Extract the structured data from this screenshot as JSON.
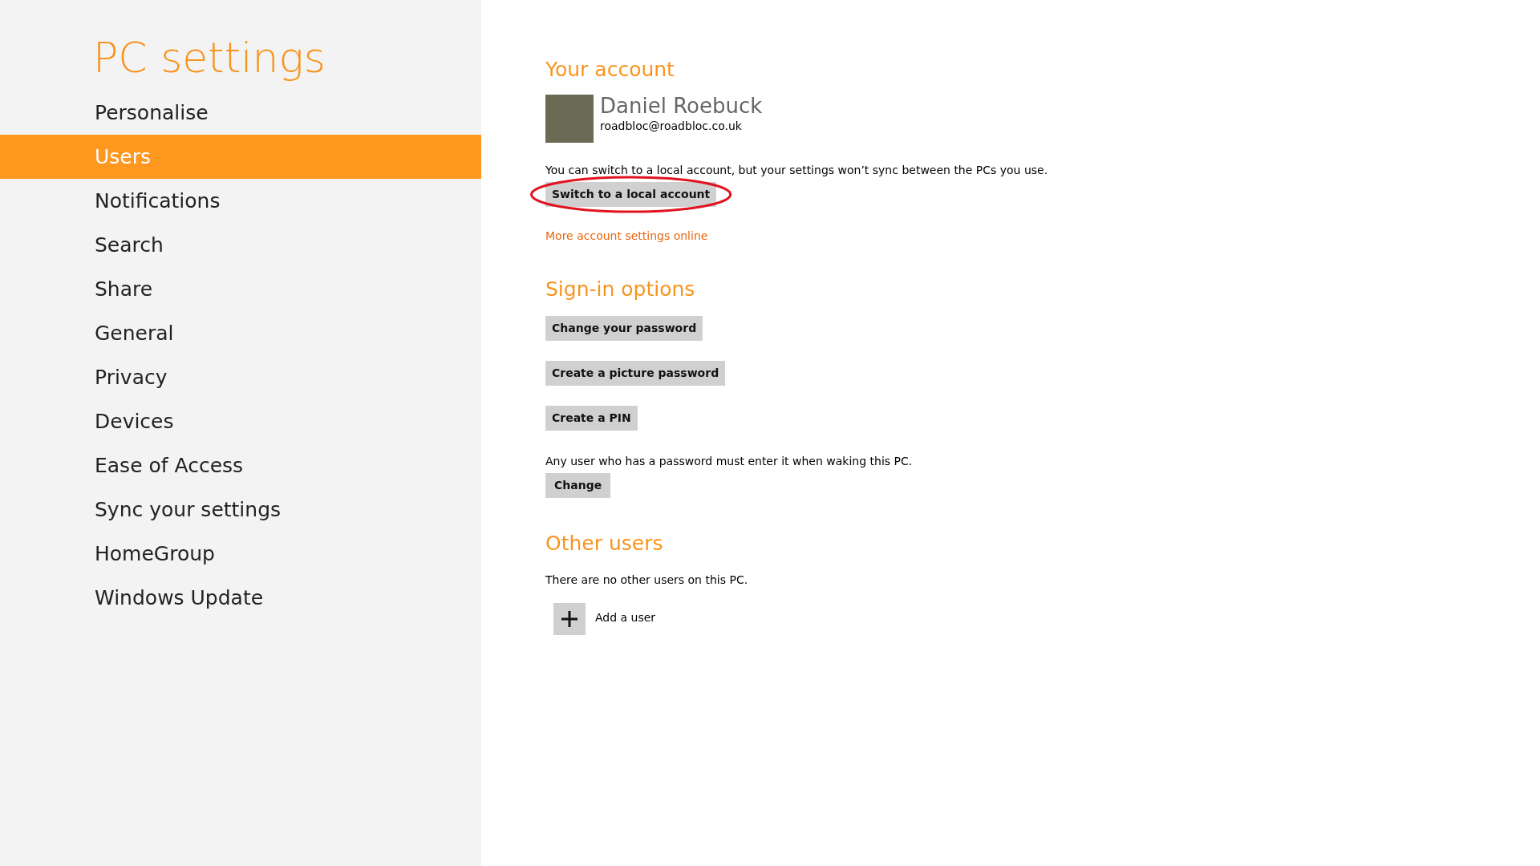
{
  "sidebar": {
    "title": "PC settings",
    "items": [
      {
        "label": "Personalise",
        "selected": false
      },
      {
        "label": "Users",
        "selected": true
      },
      {
        "label": "Notifications",
        "selected": false
      },
      {
        "label": "Search",
        "selected": false
      },
      {
        "label": "Share",
        "selected": false
      },
      {
        "label": "General",
        "selected": false
      },
      {
        "label": "Privacy",
        "selected": false
      },
      {
        "label": "Devices",
        "selected": false
      },
      {
        "label": "Ease of Access",
        "selected": false
      },
      {
        "label": "Sync your settings",
        "selected": false
      },
      {
        "label": "HomeGroup",
        "selected": false
      },
      {
        "label": "Windows Update",
        "selected": false
      }
    ]
  },
  "account": {
    "heading": "Your account",
    "name": "Daniel Roebuck",
    "email": "roadbloc@roadbloc.co.uk",
    "note": "You can switch to a local account, but your settings won’t sync between the PCs you use.",
    "button": {
      "label": "Switch to a local account",
      "circled": true
    },
    "link": "More account settings online"
  },
  "sign_in": {
    "heading": "Sign-in options",
    "buttons": [
      "Change your password",
      "Create a picture password",
      "Create a PIN"
    ],
    "note": "Any user who has a password must enter it when waking this PC.",
    "button": "Change"
  },
  "other_users": {
    "heading": "Other users",
    "note": "There are no other users on this PC.",
    "add_label": "Add a user"
  }
}
